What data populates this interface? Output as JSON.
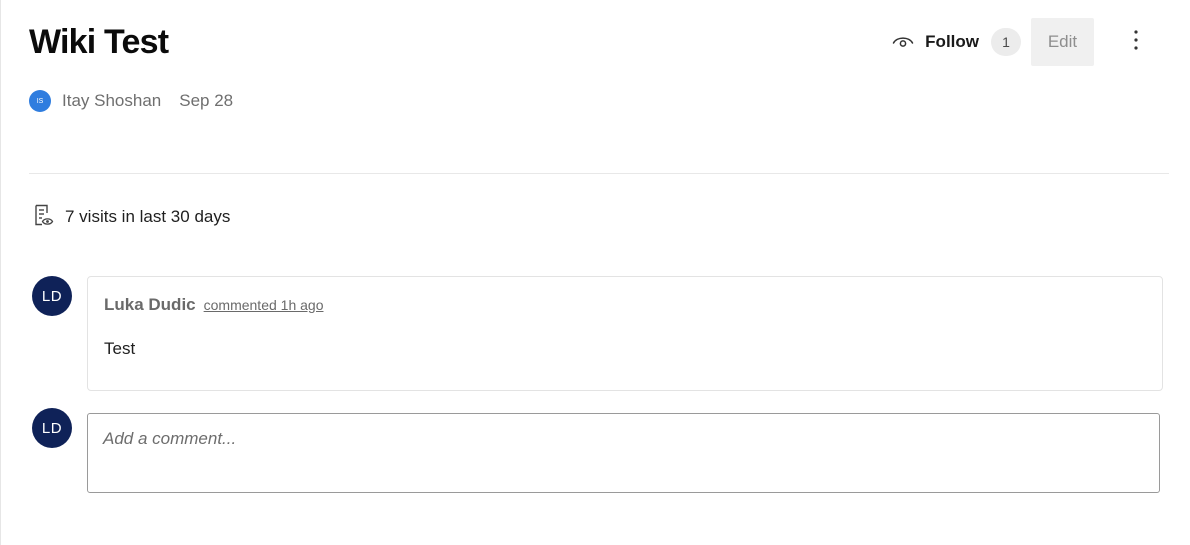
{
  "page": {
    "title": "Wiki Test"
  },
  "header": {
    "follow_label": "Follow",
    "follow_count": "1",
    "edit_label": "Edit",
    "icons": {
      "follow": "eye-icon",
      "more": "more-vertical-icon"
    }
  },
  "author": {
    "initials": "IS",
    "name": "Itay Shoshan",
    "date": "Sep 28",
    "avatar_color": "#2f7ddf"
  },
  "stats": {
    "visits_text": "7 visits in last 30 days",
    "icon": "page-visits-icon"
  },
  "comments": [
    {
      "avatar_initials": "LD",
      "author": "Luka Dudic",
      "time": "commented 1h ago",
      "body": "Test",
      "avatar_color": "#0f2258"
    }
  ],
  "composer": {
    "avatar_initials": "LD",
    "placeholder": "Add a comment..."
  },
  "colors": {
    "edit_bg": "#f0f0f0",
    "count_bg": "#ececec",
    "divider": "#e8e8e8"
  }
}
